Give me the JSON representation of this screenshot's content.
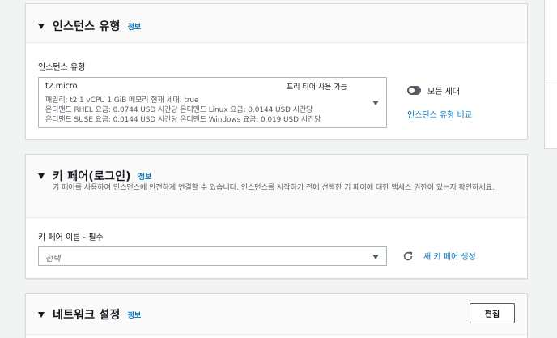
{
  "instance_type": {
    "title": "인스턴스 유형",
    "info": "정보",
    "field_label": "인스턴스 유형",
    "selected": {
      "name": "t2.micro",
      "badge": "프리 티어 사용 가능",
      "line1": "패밀리: t2    1 vCPU    1 GiB 메모리    현재 세대: true",
      "line2": "온디맨드 RHEL 요금: 0.0744 USD 시간당    온디맨드 Linux 요금: 0.0144 USD 시간당",
      "line3": "온디맨드 SUSE 요금: 0.0144 USD 시간당    온디맨드 Windows 요금: 0.019 USD 시간당"
    },
    "toggle_label": "모든 세대",
    "toggle_on": false,
    "compare_link": "인스턴스 유형 비교"
  },
  "key_pair": {
    "title": "키 페어(로그인)",
    "info": "정보",
    "description": "키 페어를 사용하여 인스턴스에 안전하게 연결할 수 있습니다. 인스턴스를 시작하기 전에 선택한 키 페어에 대한 액세스 권한이 있는지 확인하세요.",
    "field_label": "키 페어 이름 - 필수",
    "placeholder": "선택",
    "create_link": "새 키 페어 생성"
  },
  "network": {
    "title": "네트워크 설정",
    "info": "정보",
    "edit_button": "편집"
  }
}
